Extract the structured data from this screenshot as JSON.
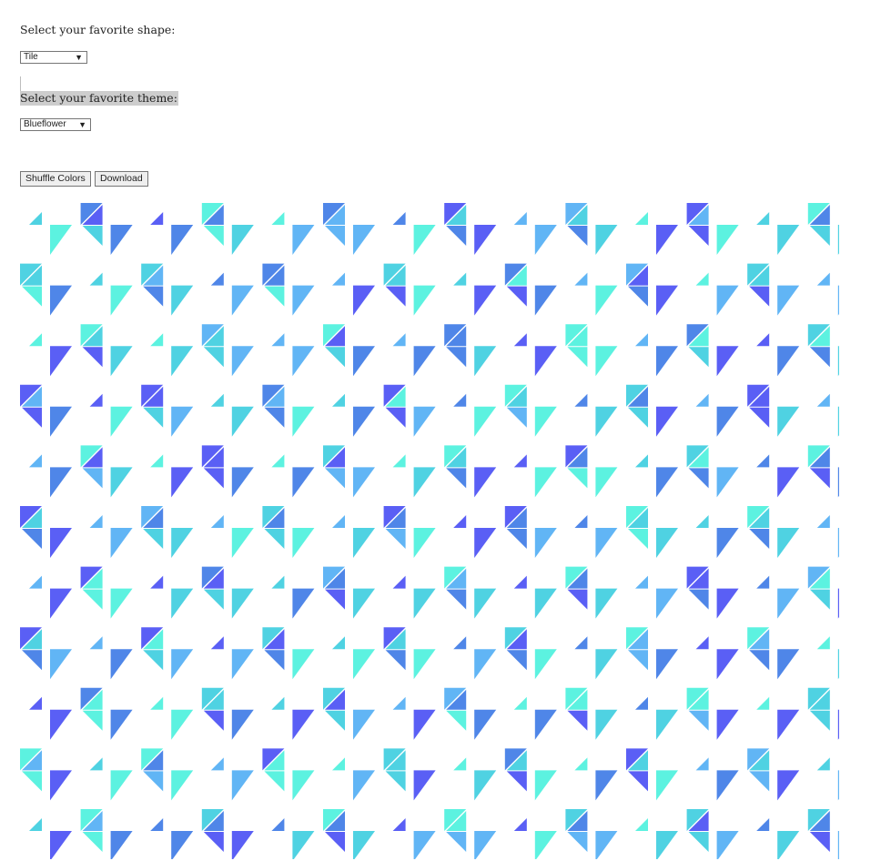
{
  "shape_section": {
    "label": "Select your favorite shape:",
    "selected": "Tile"
  },
  "theme_section": {
    "label": "Select your favorite theme:",
    "selected": "Blueflower"
  },
  "buttons": {
    "shuffle_label": "Shuffle Colors",
    "download_label": "Download"
  },
  "dropdown_arrow": "▼",
  "pattern": {
    "shape": "Tile",
    "theme": "Blueflower",
    "rows": 11,
    "columns": 14,
    "palette": [
      "#5a5ff5",
      "#4f86e8",
      "#61b5f5",
      "#4fd2e2",
      "#5cf2e0"
    ]
  }
}
